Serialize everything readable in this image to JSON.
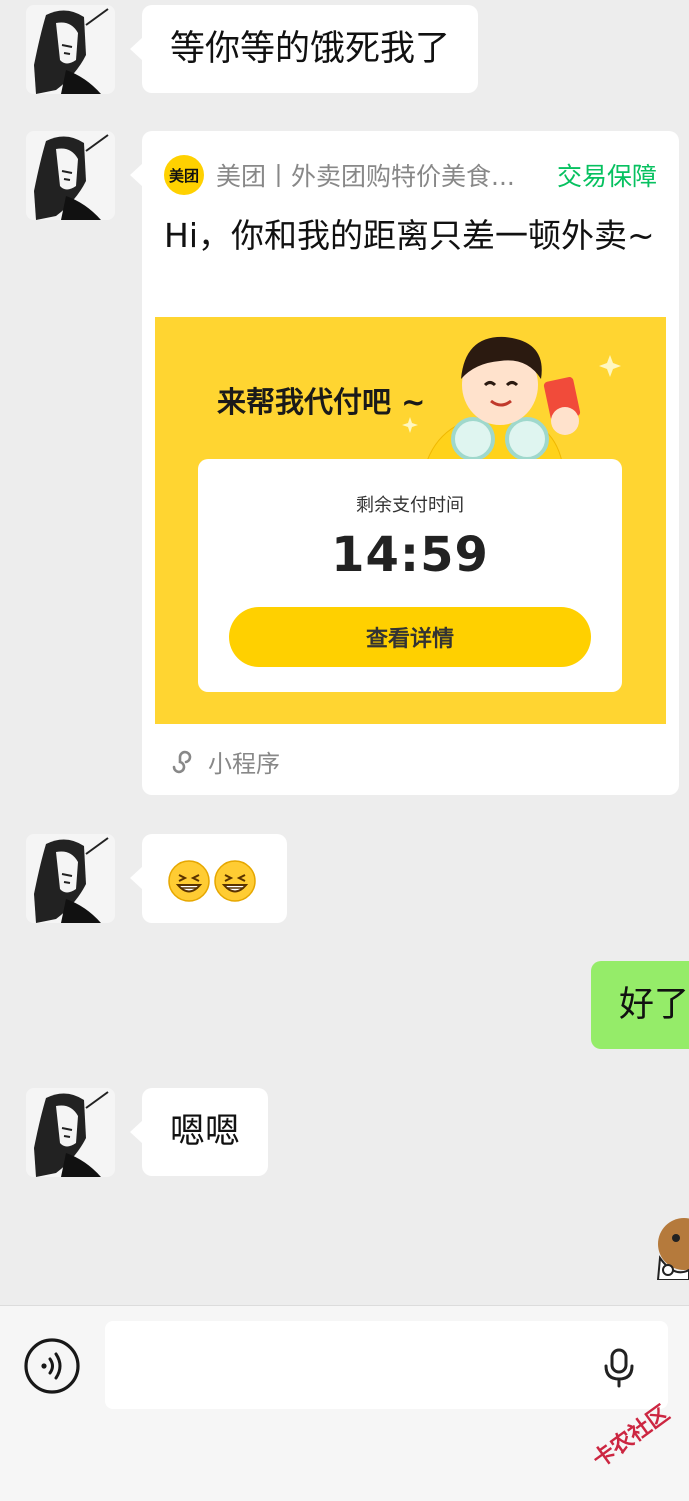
{
  "messages": {
    "m1": {
      "text": "等你等的饿死我了"
    },
    "m2": {
      "brand_logo_text": "美团",
      "brand_name": "美团丨外卖团购特价美食...",
      "guarantee": "交易保障",
      "title": "Hi，你和我的距离只差一顿外卖~",
      "banner_slogan": "来帮我代付吧 ~",
      "pay_label": "剩余支付时间",
      "pay_timer": "14:59",
      "pay_button": "查看详情",
      "footer_label": "小程序"
    },
    "m3": {
      "emoji": [
        "grinning-squint-icon",
        "grinning-squint-icon"
      ]
    },
    "m4": {
      "text": "好了"
    },
    "m5": {
      "text": "嗯嗯"
    }
  },
  "input": {
    "placeholder": ""
  },
  "watermark": "卡农社区",
  "colors": {
    "chat_bg": "#ededed",
    "self_bubble": "#95ec69",
    "guarantee_green": "#07c160",
    "meituan_yellow": "#ffd000"
  }
}
